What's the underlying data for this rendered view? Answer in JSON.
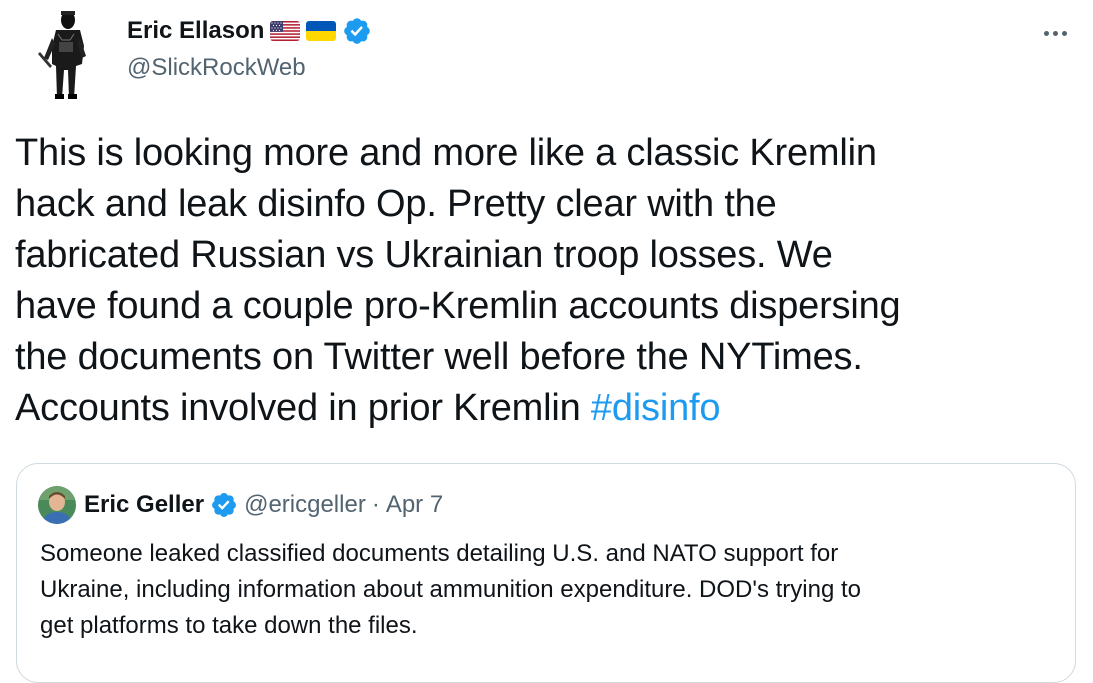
{
  "author": {
    "display_name": "Eric Ellason",
    "handle": "@SlickRockWeb",
    "flags": [
      "us-flag-icon",
      "ukraine-flag-icon"
    ],
    "verified": true
  },
  "tweet": {
    "lines": [
      "This is looking more and more like a classic Kremlin",
      "hack and leak disinfo Op. Pretty clear with the",
      "fabricated Russian vs Ukrainian troop losses. We",
      "have found a couple pro-Kremlin accounts dispersing",
      "the documents on Twitter well before the NYTimes.",
      "Accounts involved in prior Kremlin "
    ],
    "hashtag": "#disinfo"
  },
  "quoted_tweet": {
    "display_name": "Eric Geller",
    "handle": "@ericgeller",
    "separator": "·",
    "date": "Apr 7",
    "verified": true,
    "lines": [
      "Someone leaked classified documents detailing U.S. and NATO support for",
      "Ukraine, including information about ammunition expenditure. DOD's trying to",
      "get platforms to take down the files."
    ]
  },
  "icons": {
    "more": "more-options-icon",
    "verified": "verified-badge-icon"
  },
  "colors": {
    "text": "#0f1419",
    "secondary": "#536471",
    "accent": "#1d9bf0",
    "border": "#cfd9de"
  }
}
